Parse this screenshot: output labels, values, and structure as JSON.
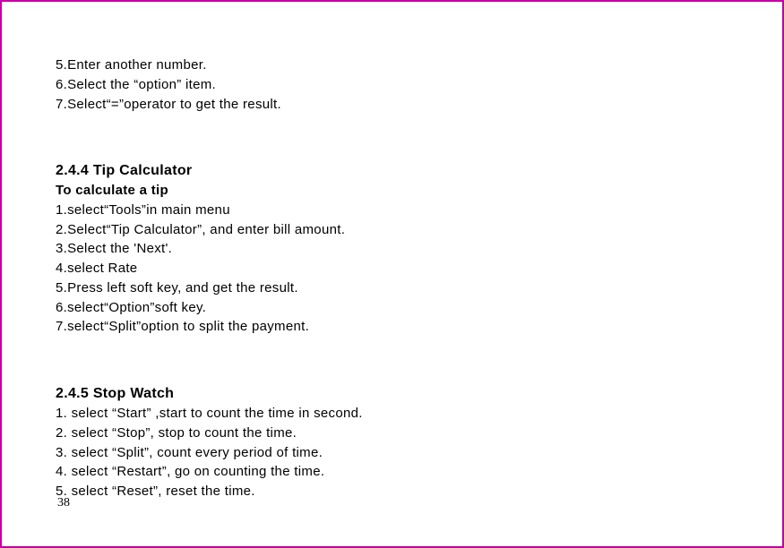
{
  "page_number": "38",
  "lines": [
    {
      "text": "5.Enter another number.",
      "style": "line"
    },
    {
      "text": "6.Select the “option” item.",
      "style": "line"
    },
    {
      "text": "7.Select“=”operator  to get the result.",
      "style": "line"
    },
    {
      "text": "",
      "style": "blank"
    },
    {
      "text": "2.4.4 Tip Calculator",
      "style": "section"
    },
    {
      "text": "To calculate a tip",
      "style": "bold"
    },
    {
      "text": "1.select“Tools”in main menu",
      "style": "line"
    },
    {
      "text": "2.Select“Tip Calculator”, and  enter bill amount.",
      "style": "line"
    },
    {
      "text": "3.Select the 'Next'.",
      "style": "line"
    },
    {
      "text": "4.select Rate",
      "style": "line"
    },
    {
      "text": "5.Press left soft key, and get the result.",
      "style": "line"
    },
    {
      "text": "6.select“Option”soft key.",
      "style": "line"
    },
    {
      "text": "7.select“Split”option to split the payment.",
      "style": "line"
    },
    {
      "text": "",
      "style": "blank"
    },
    {
      "text": "2.4.5 Stop Watch",
      "style": "section"
    },
    {
      "text": "1. select “Start” ,start to count the time in second.",
      "style": "line"
    },
    {
      "text": "2. select “Stop”, stop to count the time.",
      "style": "line"
    },
    {
      "text": "3. select “Split”, count every period of time.",
      "style": "line"
    },
    {
      "text": "4. select “Restart”, go on counting the time.",
      "style": "line"
    },
    {
      "text": "5. select “Reset”, reset the time.",
      "style": "line"
    }
  ]
}
